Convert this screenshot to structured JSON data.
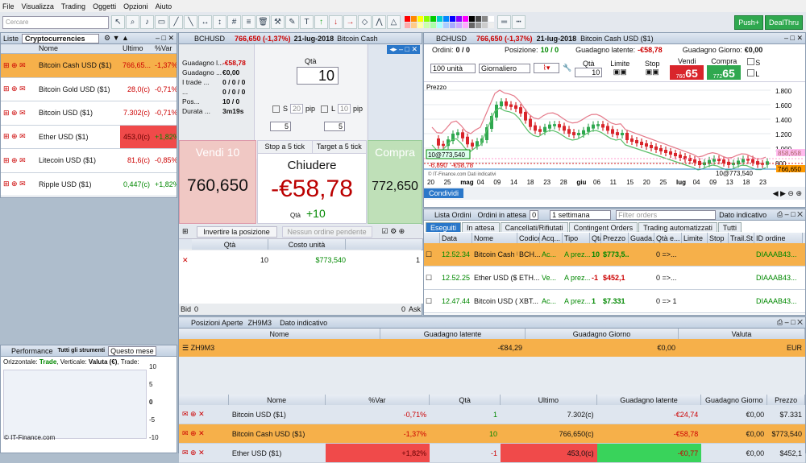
{
  "menu": [
    "File",
    "Visualizza",
    "Trading",
    "Oggetti",
    "Opzioni",
    "Aiuto"
  ],
  "search_placeholder": "Cercare",
  "push_label": "Push+",
  "dealthru_label": "DealThru",
  "watchlist": {
    "title": "Liste",
    "list_name": "Cryptocurrencies",
    "columns": [
      "Nome",
      "Ultimo",
      "%Var"
    ],
    "rows": [
      {
        "name": "Bitcoin Cash USD ($1)",
        "last": "766,65...",
        "var": "-1,37%",
        "hl": "orange"
      },
      {
        "name": "Bitcoin Gold USD ($1)",
        "last": "28,0(c)",
        "var": "-0,71%",
        "hl": ""
      },
      {
        "name": "Bitcoin USD ($1)",
        "last": "7.302(c)",
        "var": "-0,71%",
        "hl": ""
      },
      {
        "name": "Ether USD ($1)",
        "last": "453,0(c)",
        "var": "+1,82%",
        "hl": "red"
      },
      {
        "name": "Litecoin USD ($1)",
        "last": "81,6(c)",
        "var": "-0,85%",
        "hl": ""
      },
      {
        "name": "Ripple USD ($1)",
        "last": "0,447(c)",
        "var": "+1,82%",
        "hl": ""
      }
    ]
  },
  "ticket": {
    "symbol": "BCHUSD",
    "price": "766,650 (-1,37%)",
    "date": "21-lug-2018",
    "name": "Bitcoin Cash",
    "stats": [
      {
        "l": "Guadagno l...",
        "v": "-€58,78",
        "c": "neg"
      },
      {
        "l": "Guadagno ...",
        "v": "€0,00",
        "c": ""
      },
      {
        "l": "I trade ...",
        "v": "0 / 0 / 0",
        "c": ""
      },
      {
        "l": "...",
        "v": "0 / 0 / 0",
        "c": ""
      },
      {
        "l": "Pos...",
        "v": "10 / 0",
        "c": ""
      },
      {
        "l": "Durata ...",
        "v": "3m19s",
        "c": ""
      }
    ],
    "qty_label": "Qtà",
    "qty": "10",
    "s_label": "S",
    "s_val": "20",
    "l_label": "L",
    "l_val": "10",
    "pip": "pip",
    "step1": "5",
    "step2": "5",
    "sell_label": "Vendi 10",
    "sell_price": "760,650",
    "buy_label": "Compra",
    "buy_price": "772,650",
    "stop_label": "Stop a 5 tick",
    "target_label": "Target a 5 tick",
    "close_label": "Chiudere",
    "pl": "-€58,78",
    "close_qty_label": "Qtà",
    "close_qty": "+10",
    "invert_label": "Invertire la posizione",
    "pending_label": "Nessun ordine pendente",
    "pos_cols": [
      "Qtà",
      "Costo unità"
    ],
    "pos_row": {
      "qty": "10",
      "cost": "$773,540",
      "n": "1"
    },
    "bid": "Bid",
    "ask": "Ask",
    "bid_val": "0",
    "ask_val": "0"
  },
  "chart": {
    "symbol": "BCHUSD",
    "price": "766,650 (-1,37%)",
    "date": "21-lug-2018",
    "name": "Bitcoin Cash USD ($1)",
    "orders_label": "Ordini:",
    "orders_val": "0 / 0",
    "pos_label": "Posizione:",
    "pos_val": "10 / 0",
    "gl_label": "Guadagno latente:",
    "gl_val": "-€58,78",
    "gg_label": "Guadagno Giorno:",
    "gg_val": "€0,00",
    "units": "100 unità",
    "period": "Giornaliero",
    "qty_label": "Qtà",
    "qty": "10",
    "limit_label": "Limite",
    "stop_label": "Stop",
    "sell_label": "Vendi",
    "sell_big": "65",
    "sell_small": "760",
    "buy_label": "Compra",
    "buy_big": "65",
    "buy_small": "772",
    "s_label": "S",
    "l_label": "L",
    "pane_label": "Prezzo",
    "credit": "© IT-Finance.com  Dati indicativi",
    "pos_tag": "10@773,540",
    "pos_pl1": "-6,890",
    "pos_pl2": "-€58,78",
    "pos_tag2": "10@773,540",
    "tag_a": "858,658",
    "tag_b": "766,650",
    "share_label": "Condividi",
    "y_ticks": [
      "1.800",
      "1.600",
      "1.400",
      "1.200",
      "1.000",
      "800"
    ],
    "x_ticks": [
      "20",
      "25",
      "mag",
      "04",
      "09",
      "14",
      "18",
      "23",
      "28",
      "giu",
      "06",
      "11",
      "15",
      "20",
      "25",
      "lug",
      "04",
      "09",
      "13",
      "18",
      "23"
    ]
  },
  "orders": {
    "title": "Lista Ordini",
    "pending_label": "Ordini in attesa",
    "pending_count": "0",
    "period": "1 settimana",
    "filter_placeholder": "Filter orders",
    "indicative": "Dato indicativo",
    "tabs": [
      "Eseguiti",
      "In attesa",
      "Cancellati/Rifiutati",
      "Contingent Orders",
      "Trading automatizzati",
      "Tutti"
    ],
    "columns": [
      "Data",
      "Nome",
      "Codice",
      "Acq...",
      "Tipo",
      "Qtà",
      "Prezzo",
      "Guada...",
      "Qtà e...",
      "Limite",
      "Stop",
      "Trail.St...",
      "ID ordine"
    ],
    "rows": [
      {
        "time": "12.52.34",
        "name": "Bitcoin Cash U...",
        "code": "BCH...",
        "side": "Ac...",
        "type": "A prez...",
        "qty": "10",
        "price": "$773,5...",
        "gl": "",
        "exec": "0 =>...",
        "id": "DIAAAB43...",
        "hl": true
      },
      {
        "time": "12.52.25",
        "name": "Ether USD ($1)",
        "code": "ETH...",
        "side": "Ve...",
        "type": "A prez...",
        "qty": "-1",
        "price": "$452,1",
        "gl": "",
        "exec": "0 =>...",
        "id": "DIAAAB43...",
        "hl": false
      },
      {
        "time": "12.47.44",
        "name": "Bitcoin USD ($1)",
        "code": "XBT...",
        "side": "Ac...",
        "type": "A prez...",
        "qty": "1",
        "price": "$7.331",
        "gl": "",
        "exec": "0 => 1",
        "id": "DIAAAB43...",
        "hl": false
      }
    ]
  },
  "perf": {
    "title": "Performance",
    "tools": "Tutti gli strumenti",
    "period": "Questo mese",
    "legend_a": "Orizzontale:",
    "legend_b": "Trade",
    "legend_c": "Verticale:",
    "legend_d": "Valuta (€)",
    "legend_e": "Trade:",
    "y": [
      "10",
      "5",
      "0",
      "-5",
      "-10"
    ],
    "credit": "© IT-Finance.com"
  },
  "positions": {
    "title": "Posizioni Aperte",
    "code": "ZH9M3",
    "indicative": "Dato indicativo",
    "acct_cols": [
      "Nome",
      "Guadagno latente",
      "Guadagno Giorno",
      "Valuta"
    ],
    "acct_row": {
      "name": "ZH9M3",
      "gl": "-€84,29",
      "gg": "€0,00",
      "cur": "EUR"
    },
    "cols": [
      "Nome",
      "%Var",
      "Qtà",
      "Ultimo",
      "Guadagno latente",
      "Guadagno Giorno",
      "Prezzo"
    ],
    "rows": [
      {
        "name": "Bitcoin USD ($1)",
        "var": "-0,71%",
        "qty": "1",
        "last": "7.302(c)",
        "gl": "-€24,74",
        "gg": "€0,00",
        "price": "$7.331",
        "hl": ""
      },
      {
        "name": "Bitcoin Cash USD ($1)",
        "var": "-1,37%",
        "qty": "10",
        "last": "766,650(c)",
        "gl": "-€58,78",
        "gg": "€0,00",
        "price": "$773,540",
        "hl": "orange"
      },
      {
        "name": "Ether USD ($1)",
        "var": "+1,82%",
        "qty": "-1",
        "last": "453,0(c)",
        "gl": "-€0,77",
        "gg": "€0,00",
        "price": "$452,1",
        "hl": "ether"
      }
    ]
  }
}
